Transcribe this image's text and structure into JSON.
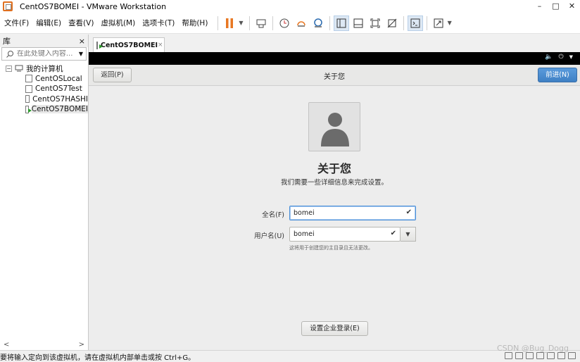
{
  "window": {
    "title": "CentOS7BOMEI - VMware Workstation",
    "controls": [
      "–",
      "□",
      "✕"
    ]
  },
  "menu": [
    "文件(F)",
    "编辑(E)",
    "查看(V)",
    "虚拟机(M)",
    "选项卡(T)",
    "帮助(H)"
  ],
  "library": {
    "title": "库",
    "close": "×",
    "search_placeholder": "在此处键入内容...",
    "root": "我的计算机",
    "items": [
      "CentOSLocal",
      "CentOS7Test",
      "CentOS7HASHI",
      "CentOS7BOMEI"
    ],
    "selected": "CentOS7BOMEI"
  },
  "tab": {
    "label": "CentOS7BOMEI",
    "close": "×"
  },
  "vm": {
    "header": {
      "back": "返回(P)",
      "title": "关于您",
      "next": "前进(N)"
    },
    "heading": "关于您",
    "subheading": "我们需要一些详细信息来完成设置。",
    "fullname": {
      "label": "全名(F)",
      "value": "bomei"
    },
    "username": {
      "label": "用户名(U)",
      "value": "bomei",
      "hint": "这将用于创建您的主目录且无法更改。"
    },
    "enterprise_button": "设置企业登录(E)"
  },
  "status": {
    "text": "要将输入定向到该虚拟机，请在虚拟机内部单击或按 Ctrl+G。",
    "watermark": "CSDN @Bug_Dogg"
  },
  "colors": {
    "accent": "#3f80c4",
    "pause": "#e87722"
  }
}
